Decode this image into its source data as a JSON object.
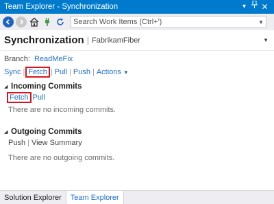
{
  "window": {
    "title": "Team Explorer - Synchronization",
    "dropdown_glyph": "▾",
    "pin_glyph": "ᵖ",
    "close_glyph": "✕"
  },
  "toolbar": {
    "back_icon": "back-arrow-icon",
    "forward_icon": "forward-arrow-icon",
    "home_icon": "home-icon",
    "connect_icon": "plug-icon",
    "refresh_icon": "refresh-icon",
    "search": {
      "placeholder": "Search Work Items (Ctrl+')",
      "value": ""
    }
  },
  "page": {
    "title": "Synchronization",
    "separator": "|",
    "project": "FabrikamFiber"
  },
  "branch": {
    "label": "Branch:",
    "name": "ReadMeFix"
  },
  "actions": {
    "sync": "Sync",
    "fetch": "Fetch",
    "pull": "Pull",
    "push": "Push",
    "more": "Actions"
  },
  "incoming": {
    "title": "Incoming Commits",
    "fetch": "Fetch",
    "pull": "Pull",
    "empty": "There are no incoming commits."
  },
  "outgoing": {
    "title": "Outgoing Commits",
    "push": "Push",
    "view_summary": "View Summary",
    "empty": "There are no outgoing commits."
  },
  "bottom_tabs": [
    {
      "label": "Solution Explorer",
      "active": false
    },
    {
      "label": "Team Explorer",
      "active": true
    }
  ],
  "colors": {
    "title_bar": "#007acc",
    "link": "#1e6fd0",
    "highlight": "#d9161d"
  }
}
